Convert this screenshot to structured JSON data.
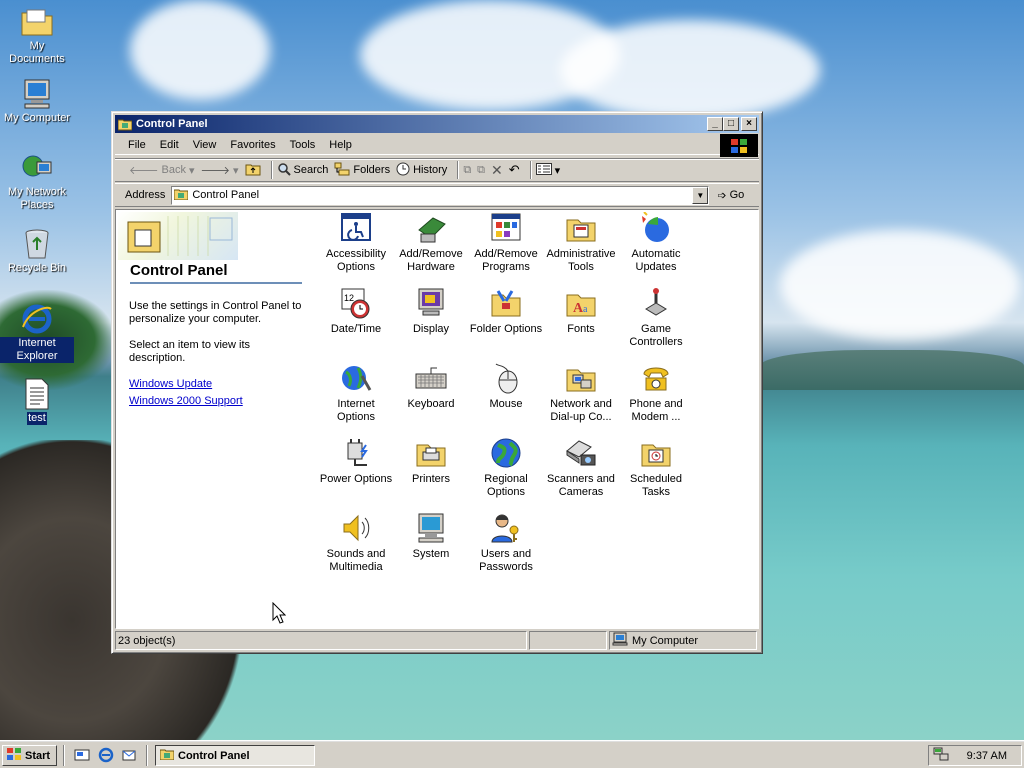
{
  "desktop": {
    "icons": [
      {
        "label": "My Documents"
      },
      {
        "label": "My Computer"
      },
      {
        "label": "My Network Places"
      },
      {
        "label": "Recycle Bin"
      },
      {
        "label": "Internet Explorer"
      },
      {
        "label": "test"
      }
    ]
  },
  "window": {
    "title": "Control Panel",
    "menu": [
      "File",
      "Edit",
      "View",
      "Favorites",
      "Tools",
      "Help"
    ],
    "toolbar": {
      "back": "Back",
      "search": "Search",
      "folders": "Folders",
      "history": "History"
    },
    "address": {
      "label": "Address",
      "value": "Control Panel",
      "go": "Go"
    }
  },
  "left_pane": {
    "title": "Control Panel",
    "desc1": "Use the settings in Control Panel to personalize your computer.",
    "desc2": "Select an item to view its description.",
    "links": [
      "Windows Update",
      "Windows 2000 Support"
    ]
  },
  "items": [
    {
      "label": "Accessibility Options"
    },
    {
      "label": "Add/Remove Hardware"
    },
    {
      "label": "Add/Remove Programs"
    },
    {
      "label": "Administrative Tools"
    },
    {
      "label": "Automatic Updates"
    },
    {
      "label": "Date/Time"
    },
    {
      "label": "Display"
    },
    {
      "label": "Folder Options"
    },
    {
      "label": "Fonts"
    },
    {
      "label": "Game Controllers"
    },
    {
      "label": "Internet Options"
    },
    {
      "label": "Keyboard"
    },
    {
      "label": "Mouse"
    },
    {
      "label": "Network and Dial-up Co..."
    },
    {
      "label": "Phone and Modem ..."
    },
    {
      "label": "Power Options"
    },
    {
      "label": "Printers"
    },
    {
      "label": "Regional Options"
    },
    {
      "label": "Scanners and Cameras"
    },
    {
      "label": "Scheduled Tasks"
    },
    {
      "label": "Sounds and Multimedia"
    },
    {
      "label": "System"
    },
    {
      "label": "Users and Passwords"
    }
  ],
  "status": {
    "count": "23 object(s)",
    "zone": "My Computer"
  },
  "taskbar": {
    "start": "Start",
    "task": "Control Panel",
    "clock": "9:37 AM"
  }
}
